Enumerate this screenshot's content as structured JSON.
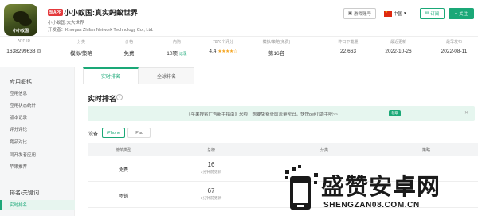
{
  "app": {
    "icon_caption": "小小蚁国",
    "badge": "玩APP",
    "title": "小小蚁国:真实蚂蚁世界",
    "subtitle": "小小蚁国:大大世界",
    "developer": "开发者：Khorgas Zhifan Network Technology Co., Ltd."
  },
  "header_actions": {
    "game_account": "游戏账号",
    "region": "中国",
    "subscribe": "订阅",
    "follow": "关注"
  },
  "stats": [
    {
      "label": "APP ID",
      "value": "1638299638"
    },
    {
      "label": "分类",
      "value": "模拟/策略"
    },
    {
      "label": "价格",
      "value": "免费"
    },
    {
      "label": "内购",
      "value": "10项",
      "extra": "记录"
    },
    {
      "label": "7870个评分",
      "value": "4.4"
    },
    {
      "label": "模拟/策略(免费)",
      "value": "第16名"
    },
    {
      "label": "昨日下载量",
      "value": "22,663"
    },
    {
      "label": "最近更新",
      "value": "2022-10-26"
    },
    {
      "label": "最早发布",
      "value": "2022-08-11"
    }
  ],
  "sidebar": {
    "section1": "应用概括",
    "items1": [
      "应用信息",
      "应用状态统计",
      "版本记录",
      "评分评论",
      "竞品对比",
      "同开发者应用",
      "苹果推荐"
    ],
    "section2": "排名/关键词",
    "active": "实时排名"
  },
  "tabs": [
    "实时排名",
    "全球排名"
  ],
  "section_title": "实时排名",
  "banner": {
    "text": "《苹果搜索广告新手指南》来啦！想要免费获取流量密码，快快get小助手吧~~",
    "go": "领取"
  },
  "device": {
    "label": "设备",
    "options": [
      "iPhone",
      "iPad"
    ]
  },
  "table": {
    "headers": [
      "榜单类型",
      "总榜",
      "分类",
      "游戏",
      "策略"
    ],
    "rows": [
      {
        "type": "免费",
        "rank": "16",
        "update": "1分钟前更新"
      },
      {
        "type": "畅销",
        "rank": "67",
        "update": "1分钟前更新"
      }
    ]
  },
  "watermark": {
    "cn": "盛赞安卓网",
    "en": "SHENGZAN08.COM.CN"
  },
  "colors": {
    "accent": "#1aa877",
    "badge": "#e4393c",
    "star": "#f5a623"
  }
}
